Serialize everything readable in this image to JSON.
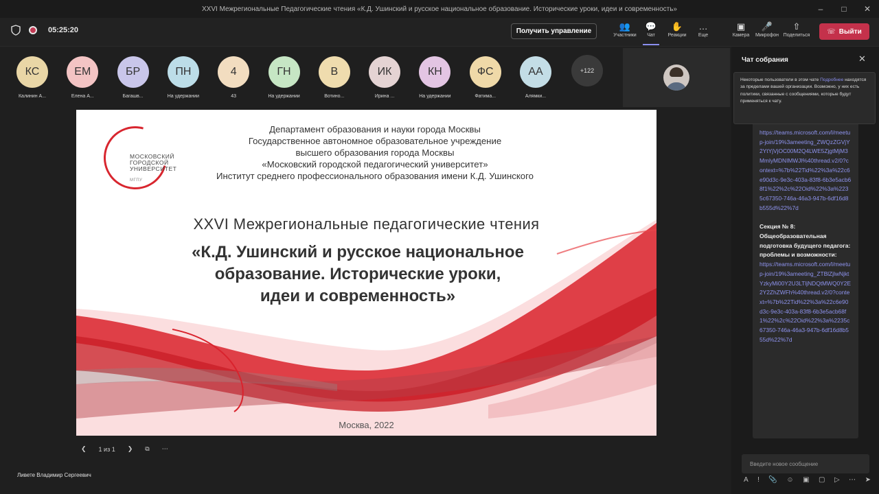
{
  "window": {
    "title": "XXVI Межрегиональные Педагогические чтения «К.Д. Ушинский и русское национальное образование. Исторические уроки, идеи и современность»"
  },
  "toolbar": {
    "timer": "05:25:20",
    "request_control": "Получить управление",
    "icons": [
      {
        "label": "Участники",
        "icon": "participants-icon"
      },
      {
        "label": "Чат",
        "icon": "chat-icon"
      },
      {
        "label": "Реакции",
        "icon": "reactions-icon"
      },
      {
        "label": "Еще",
        "icon": "more-icon"
      },
      {
        "label": "Камера",
        "icon": "camera-off-icon"
      },
      {
        "label": "Микрофон",
        "icon": "mic-off-icon"
      },
      {
        "label": "Поделиться",
        "icon": "share-icon"
      }
    ],
    "leave": "Выйти"
  },
  "participants": [
    {
      "initials": "КС",
      "name": "Калинин А...",
      "color": "#e9d6a6"
    },
    {
      "initials": "ЕМ",
      "name": "Елена А...",
      "color": "#f3c4c4"
    },
    {
      "initials": "БР",
      "name": "Багашв...",
      "color": "#c9c6ea"
    },
    {
      "initials": "ПН",
      "name": "На удержании",
      "color": "#bcdde8"
    },
    {
      "initials": "4",
      "name": "43",
      "color": "#f2ddc0"
    },
    {
      "initials": "ГН",
      "name": "На удержании",
      "color": "#c6e6c4"
    },
    {
      "initials": "В",
      "name": "Вотино...",
      "color": "#efdcae"
    },
    {
      "initials": "ИК",
      "name": "Ирина ...",
      "color": "#e4d3d3"
    },
    {
      "initials": "КН",
      "name": "На удержании",
      "color": "#e3c5e3"
    },
    {
      "initials": "ФС",
      "name": "Фатима...",
      "color": "#efd9a8"
    },
    {
      "initials": "АА",
      "name": "Алямки...",
      "color": "#c3dde6"
    }
  ],
  "more_participants": "+122",
  "slide": {
    "logo_text": "МОСКОВСКИЙ\nГОРОДСКОЙ\nУНИВЕРСИТЕТ",
    "logo_sub": "МГПУ",
    "institution": [
      "Департамент образования и науки города Москвы",
      "Государственное автономное образовательное учреждение",
      "высшего образования города Москвы",
      "«Московский городской педагогический университет»",
      "Институт среднего профессионального образования имени К.Д. Ушинского"
    ],
    "subtitle": "XXVI Межрегиональные педагогические чтения",
    "title_lines": [
      "«К.Д. Ушинский и русское национальное",
      "образование. Исторические уроки,",
      "идеи и современность»"
    ],
    "city": "Москва, 2022"
  },
  "slide_nav": {
    "page": "1 из 1"
  },
  "presenter": "Ливете Владимир Сергеевич",
  "chat": {
    "title": "Чат собрания",
    "notice_text": "Некоторые пользователи в этом чате ",
    "notice_link": "Подробнее",
    "notice_rest": " находятся за пределами вашей организации. Возможно, у них есть политики, связанные с сообщениями, которые будут применяться к чату.",
    "link1": "https://teams.microsoft.com/l/meetup-join/19%3ameeting_ZWQzZGVjY2YtYjVjOC00M2Q4LWE5ZjgtMjM3MmlyMDNIMWJl%40thread.v2/0?context=%7b%22Tid%22%3a%22c6e90d3c-9e3c-403a-83f8-6b3e5acb68f1%22%2c%22Oid%22%3a%2235c67350-746a-46a3-947b-6df16d8b555d%22%7d",
    "section": "Секция № 8: Общеобразовательная подготовка будущего педагога: проблемы и возможности:",
    "link2": "https://teams.microsoft.com/l/meetup-join/19%3ameeting_ZTBlZjlwNjktYzkyMi00Y2U3LTljNDQtMWQ0Y2E2Y2ZhZWFh%40thread.v2/0?context=%7b%22Tid%22%3a%22c6e90d3c-9e3c-403a-83f8-6b3e5acb68f1%22%2c%22Oid%22%3a%2235c67350-746a-46a3-947b-6df16d8b555d%22%7d",
    "composer_placeholder": "Введите новое сообщение"
  }
}
